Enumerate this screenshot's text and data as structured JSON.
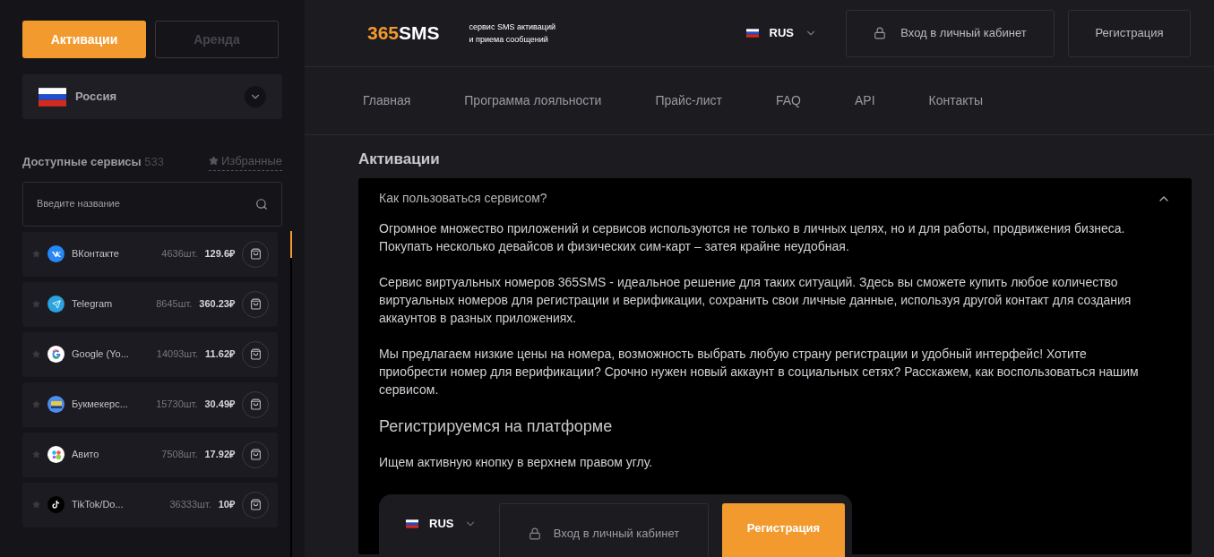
{
  "sidebar": {
    "mode_tabs": [
      {
        "label": "Активации",
        "selected": true
      },
      {
        "label": "Аренда",
        "selected": false
      }
    ],
    "country": {
      "name": "Россия"
    },
    "services_heading": {
      "title": "Доступные сервисы",
      "count": "533",
      "favorites": "Избранные"
    },
    "search": {
      "placeholder": "Введите название"
    },
    "services": [
      {
        "kind": "vk",
        "name": "ВКонтакте",
        "count": "4636шт.",
        "price": "129.6₽",
        "favorite": false
      },
      {
        "kind": "telegram",
        "name": "Telegram",
        "count": "8645шт.",
        "price": "360.23₽",
        "favorite": false
      },
      {
        "kind": "google",
        "name": "Google (Yo...",
        "count": "14093шт.",
        "price": "11.62₽",
        "favorite": false
      },
      {
        "kind": "bet",
        "name": "Букмекерс...",
        "count": "15730шт.",
        "price": "30.49₽",
        "favorite": false
      },
      {
        "kind": "avito",
        "name": "Авито",
        "count": "7508шт.",
        "price": "17.92₽",
        "favorite": false
      },
      {
        "kind": "tiktok",
        "name": "TikTok/Do...",
        "count": "36333шт.",
        "price": "10₽",
        "favorite": false
      }
    ]
  },
  "header": {
    "logo_digits": "365",
    "logo_letters": "SMS",
    "tagline": [
      "сервис SMS активаций",
      "и приема сообщений"
    ],
    "language": "RUS",
    "login": "Вход в личный кабинет",
    "register": "Регистрация"
  },
  "nav": [
    "Главная",
    "Программа лояльности",
    "Прайс-лист",
    "FAQ",
    "API",
    "Контакты"
  ],
  "content": {
    "title": "Активации",
    "faq": {
      "question": "Как пользоваться сервисом?",
      "expanded": true,
      "paragraphs": [
        "Огромное множество приложений и сервисов используются не только в личных целях, но и для работы, продвижения бизнеса. Покупать несколько девайсов и физических сим-карт – затея крайне неудобная.",
        "Сервис виртуальных номеров 365SMS - идеальное решение для таких ситуаций. Здесь вы сможете купить любое количество виртуальных номеров для регистрации и верификации, сохранить свои личные данные, используя другой контакт для создания аккаунтов в разных приложениях.",
        "Мы предлагаем низкие цены на номера, возможность выбрать любую страну регистрации и удобный интерфейс! Хотите приобрести номер для верификации? Срочно нужен новый аккаунт в социальных сетях? Расскажем, как воспользоваться нашим сервисом."
      ],
      "subheading": "Регистрируемся на платформе",
      "step": "Ищем активную кнопку в верхнем правом углу.",
      "example": {
        "language": "RUS",
        "login": "Вход в личный кабинет",
        "register": "Регистрация"
      }
    }
  }
}
